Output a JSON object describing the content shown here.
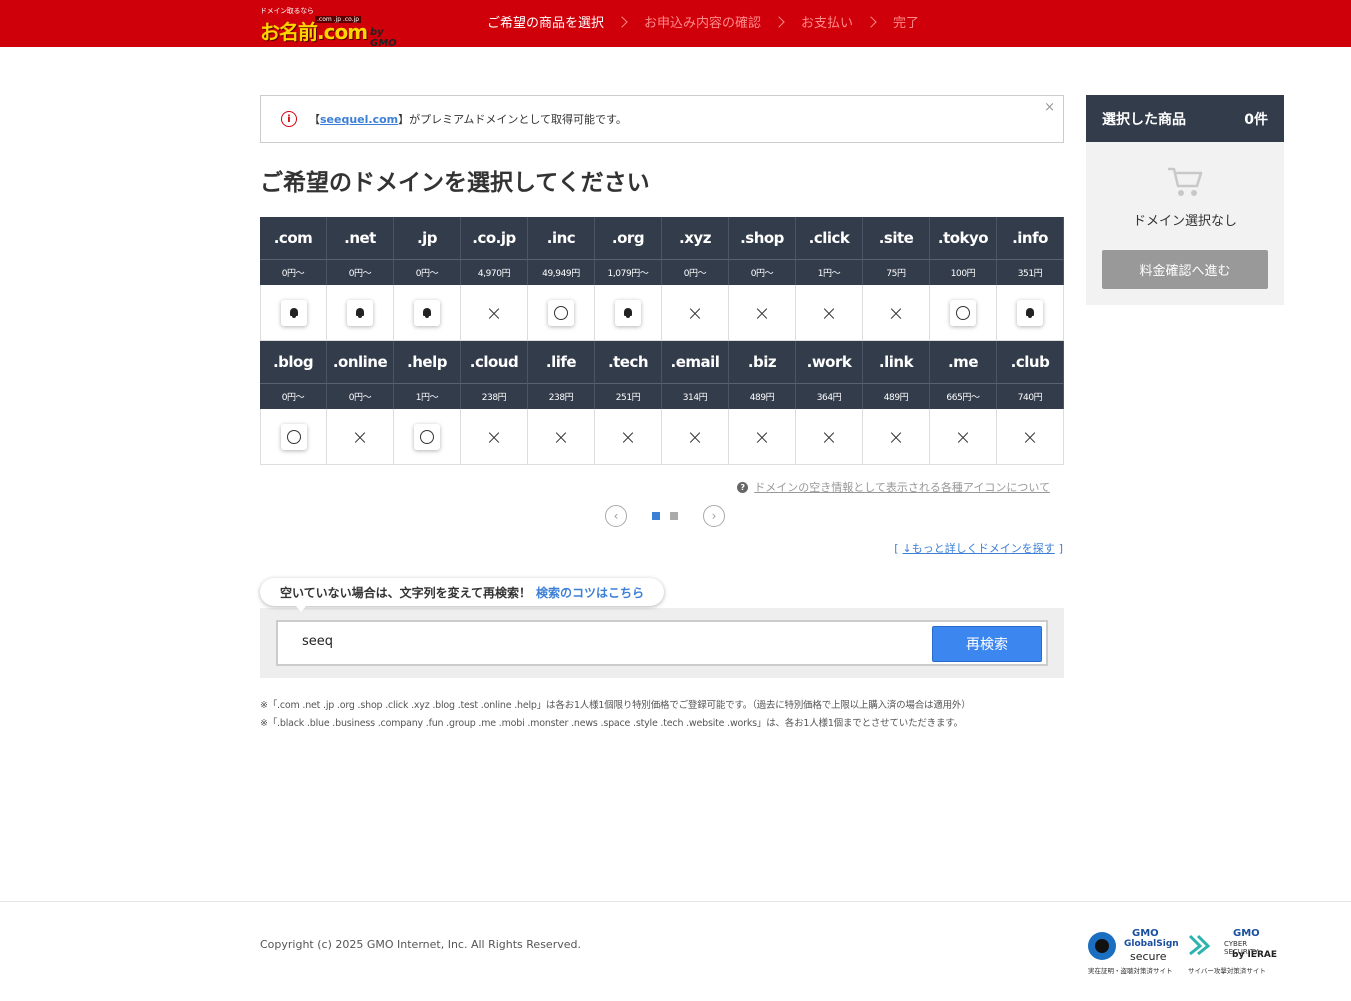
{
  "header": {
    "logo_tagline": "ドメイン取るなら",
    "logo_name": "お名前.com",
    "logo_tlds": ".com .jp .co.jp",
    "logo_by": "by GMO",
    "steps": [
      {
        "label": "ご希望の商品を選択",
        "active": true
      },
      {
        "label": "お申込み内容の確認",
        "active": false
      },
      {
        "label": "お支払い",
        "active": false
      },
      {
        "label": "完了",
        "active": false
      }
    ]
  },
  "notice": {
    "bracket_open": "【",
    "domain": "seequel.com",
    "bracket_close": "】",
    "text": "がプレミアムドメインとして取得可能です。",
    "close": "×"
  },
  "page_title": "ご希望のドメインを選択してください",
  "domains_row1": [
    {
      "tld": ".com",
      "price": "0円〜",
      "status": "bell"
    },
    {
      "tld": ".net",
      "price": "0円〜",
      "status": "bell"
    },
    {
      "tld": ".jp",
      "price": "0円〜",
      "status": "bell"
    },
    {
      "tld": ".co.jp",
      "price": "4,970円",
      "status": "cross"
    },
    {
      "tld": ".inc",
      "price": "49,949円",
      "status": "circle"
    },
    {
      "tld": ".org",
      "price": "1,079円〜",
      "status": "bell"
    },
    {
      "tld": ".xyz",
      "price": "0円〜",
      "status": "cross"
    },
    {
      "tld": ".shop",
      "price": "0円〜",
      "status": "cross"
    },
    {
      "tld": ".click",
      "price": "1円〜",
      "status": "cross"
    },
    {
      "tld": ".site",
      "price": "75円",
      "status": "cross"
    },
    {
      "tld": ".tokyo",
      "price": "100円",
      "status": "circle"
    },
    {
      "tld": ".info",
      "price": "351円",
      "status": "bell"
    }
  ],
  "domains_row2": [
    {
      "tld": ".blog",
      "price": "0円〜",
      "status": "circle"
    },
    {
      "tld": ".online",
      "price": "0円〜",
      "status": "cross"
    },
    {
      "tld": ".help",
      "price": "1円〜",
      "status": "circle"
    },
    {
      "tld": ".cloud",
      "price": "238円",
      "status": "cross"
    },
    {
      "tld": ".life",
      "price": "238円",
      "status": "cross"
    },
    {
      "tld": ".tech",
      "price": "251円",
      "status": "cross"
    },
    {
      "tld": ".email",
      "price": "314円",
      "status": "cross"
    },
    {
      "tld": ".biz",
      "price": "489円",
      "status": "cross"
    },
    {
      "tld": ".work",
      "price": "364円",
      "status": "cross"
    },
    {
      "tld": ".link",
      "price": "489円",
      "status": "cross"
    },
    {
      "tld": ".me",
      "price": "665円〜",
      "status": "cross"
    },
    {
      "tld": ".club",
      "price": "740円",
      "status": "cross"
    }
  ],
  "status_icons": {
    "cross": "×",
    "circle_icon": "circle-icon",
    "bell_icon": "bell-icon"
  },
  "help_link": "ドメインの空き情報として表示される各種アイコンについて",
  "pager": {
    "prev": "‹",
    "next": "›",
    "pages": 2,
    "current": 1
  },
  "more_link": {
    "open": "[",
    "label": "↓もっと詳しくドメインを探す",
    "close": "]"
  },
  "research": {
    "tip_text": "空いていない場合は、文字列を変えて再検索！",
    "tip_link": "検索のコツはこちら",
    "input_value": "seeq",
    "button": "再検索"
  },
  "notes": [
    "※「.com .net .jp .org .shop .click .xyz .blog .test .online .help」は各お1人様1個限り特別価格でご登録可能です。（過去に特別価格で上限以上購入済の場合は適用外）",
    "※「.black .blue .business .company .fun .group .me .mobi .monster .news .space .style .tech .website .works」は、各お1人様1個までとさせていただきます。"
  ],
  "cart": {
    "title": "選択した商品",
    "count": "0件",
    "empty": "ドメイン選択なし",
    "button": "料金確認へ進む"
  },
  "footer": {
    "copyright": "Copyright (c) 2025 GMO Internet, Inc. All Rights Reserved.",
    "badge1": {
      "gmo": "GMO",
      "name": "GlobalSign",
      "secure": "secure",
      "sub": "実在証明・盗聴対策済サイト"
    },
    "badge2": {
      "gmo": "GMO",
      "name": "CYBER SECURITY",
      "by": "by IERAE",
      "sub": "サイバー攻撃対策済サイト"
    }
  },
  "colors": {
    "header_red": "#d0000a",
    "dark_navy": "#333c4b",
    "link_blue": "#3c7fd6",
    "button_blue": "#3c86f0"
  }
}
